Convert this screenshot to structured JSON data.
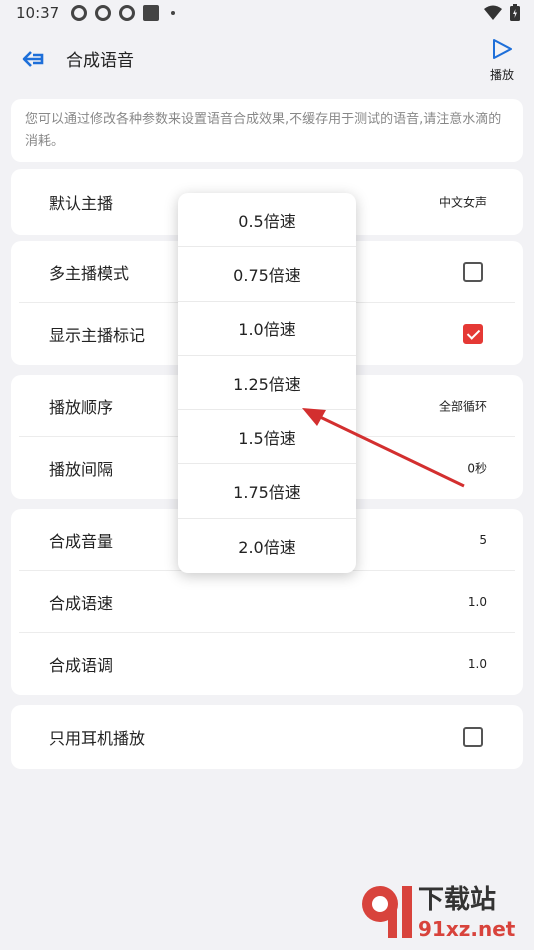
{
  "status_bar": {
    "time": "10:37"
  },
  "app_bar": {
    "title": "合成语音",
    "play_label": "播放"
  },
  "notice": "您可以通过修改各种参数来设置语音合成效果,不缓存用于测试的语音,请注意水滴的消耗。",
  "settings": {
    "voice": {
      "label": "默认主播",
      "value": "中文女声"
    },
    "multi_mode": {
      "label": "多主播模式",
      "checked": false
    },
    "show_mark": {
      "label": "显示主播标记",
      "checked": true
    },
    "play_order": {
      "label": "播放顺序",
      "value": "全部循环"
    },
    "play_interval": {
      "label": "播放间隔",
      "value": "0秒"
    },
    "volume": {
      "label": "合成音量",
      "value": "5"
    },
    "speed": {
      "label": "合成语速",
      "value": "1.0"
    },
    "pitch": {
      "label": "合成语调",
      "value": "1.0"
    },
    "headphones_only": {
      "label": "只用耳机播放",
      "checked": false
    }
  },
  "speed_menu": {
    "options": [
      "0.5倍速",
      "0.75倍速",
      "1.0倍速",
      "1.25倍速",
      "1.5倍速",
      "1.75倍速",
      "2.0倍速"
    ]
  },
  "watermark": {
    "text": "下载站",
    "domain": "91xz.net"
  },
  "colors": {
    "accent": "#1e6fd9",
    "checkbox_checked": "#e53935",
    "annotation_arrow": "#d32f2f"
  }
}
